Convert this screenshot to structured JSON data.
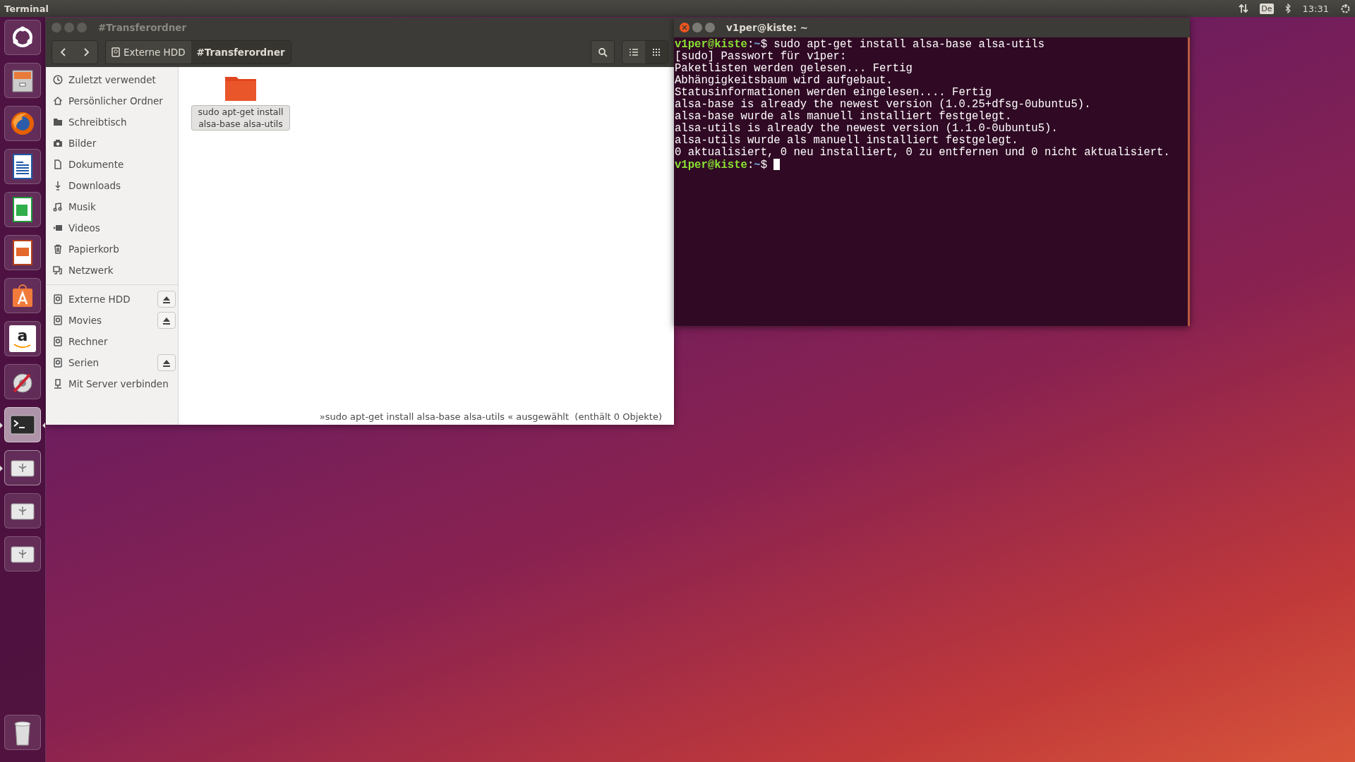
{
  "top_bar": {
    "title": "Terminal",
    "keyboard": "De",
    "time": "13:31"
  },
  "launcher": [
    {
      "kind": "dash",
      "running": false,
      "focused": false
    },
    {
      "kind": "files",
      "running": false,
      "focused": false
    },
    {
      "kind": "firefox",
      "running": false,
      "focused": false
    },
    {
      "kind": "writer",
      "running": false,
      "focused": false
    },
    {
      "kind": "calc",
      "running": false,
      "focused": false
    },
    {
      "kind": "impress",
      "running": false,
      "focused": false
    },
    {
      "kind": "software",
      "running": false,
      "focused": false
    },
    {
      "kind": "amazon",
      "glyph": "a",
      "running": false,
      "focused": false
    },
    {
      "kind": "settings",
      "running": false,
      "focused": false
    },
    {
      "kind": "terminal",
      "running": true,
      "focused": true
    },
    {
      "kind": "usb",
      "running": true,
      "focused": false
    },
    {
      "kind": "usb",
      "running": false,
      "focused": false
    },
    {
      "kind": "usb",
      "running": false,
      "focused": false
    },
    {
      "kind": "trash",
      "running": false,
      "focused": false
    }
  ],
  "file_manager": {
    "title": "#Transferordner",
    "path": [
      {
        "label": "Externe HDD",
        "kind": "drive",
        "selected": false
      },
      {
        "label": "#Transferordner",
        "kind": "folder",
        "selected": true
      }
    ],
    "view_buttons": [
      {
        "kind": "list",
        "selected": false
      },
      {
        "kind": "grid",
        "selected": true
      }
    ],
    "places": [
      {
        "label": "Zuletzt verwendet",
        "kind": "clock"
      },
      {
        "label": "Persönlicher Ordner",
        "kind": "home"
      },
      {
        "label": "Schreibtisch",
        "kind": "folder"
      },
      {
        "label": "Bilder",
        "kind": "camera"
      },
      {
        "label": "Dokumente",
        "kind": "document"
      },
      {
        "label": "Downloads",
        "kind": "download"
      },
      {
        "label": "Musik",
        "kind": "music"
      },
      {
        "label": "Videos",
        "kind": "video"
      },
      {
        "label": "Papierkorb",
        "kind": "trash"
      },
      {
        "label": "Netzwerk",
        "kind": "network"
      }
    ],
    "devices": [
      {
        "label": "Externe HDD",
        "kind": "drive",
        "eject": true
      },
      {
        "label": "Movies",
        "kind": "drive",
        "eject": true
      },
      {
        "label": "Rechner",
        "kind": "drive",
        "eject": false
      },
      {
        "label": "Serien",
        "kind": "drive",
        "eject": true
      },
      {
        "label": "Mit Server verbinden",
        "kind": "server",
        "eject": false
      }
    ],
    "files": [
      {
        "name": "sudo apt-get install alsa-base alsa-utils",
        "selected": true
      }
    ],
    "status": "»sudo apt-get install alsa-base alsa-utils « ausgewählt  (enthält 0 Objekte)"
  },
  "terminal": {
    "title": "v1per@kiste: ~",
    "lines": [
      {
        "kind": "prompt",
        "user": "v1per@kiste",
        "sep": ":",
        "path": "~",
        "symbol": "$",
        "command": " sudo apt-get install alsa-base alsa-utils",
        "cursor": false
      },
      {
        "kind": "output",
        "text": "[sudo] Passwort für v1per:"
      },
      {
        "kind": "output",
        "text": "Paketlisten werden gelesen... Fertig"
      },
      {
        "kind": "output",
        "text": "Abhängigkeitsbaum wird aufgebaut."
      },
      {
        "kind": "output",
        "text": "Statusinformationen werden eingelesen.... Fertig"
      },
      {
        "kind": "output",
        "text": "alsa-base is already the newest version (1.0.25+dfsg-0ubuntu5)."
      },
      {
        "kind": "output",
        "text": "alsa-base wurde als manuell installiert festgelegt."
      },
      {
        "kind": "output",
        "text": "alsa-utils is already the newest version (1.1.0-0ubuntu5)."
      },
      {
        "kind": "output",
        "text": "alsa-utils wurde als manuell installiert festgelegt."
      },
      {
        "kind": "output",
        "text": "0 aktualisiert, 0 neu installiert, 0 zu entfernen und 0 nicht aktualisiert."
      },
      {
        "kind": "prompt",
        "user": "v1per@kiste",
        "sep": ":",
        "path": "~",
        "symbol": "$",
        "cursor": true
      }
    ]
  }
}
